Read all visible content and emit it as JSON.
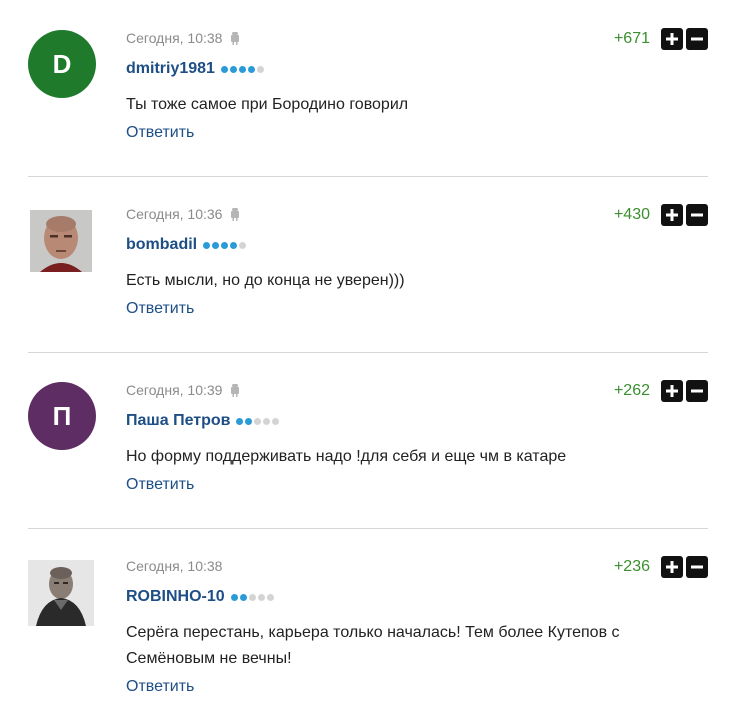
{
  "comments": [
    {
      "time": "Сегодня, 10:38",
      "author": "dmitriy1981",
      "rating_filled": 4,
      "rating_total": 5,
      "score": "+671",
      "text": "Ты тоже самое при Бородино говорил",
      "reply": "Ответить",
      "avatar_letter": "D",
      "avatar_color": "#1f7a2c",
      "mobile": true
    },
    {
      "time": "Сегодня, 10:36",
      "author": "bombadil",
      "rating_filled": 4,
      "rating_total": 5,
      "score": "+430",
      "text": "Есть мысли, но до конца не уверен)))",
      "reply": "Ответить",
      "avatar_type": "photo",
      "mobile": true
    },
    {
      "time": "Сегодня, 10:39",
      "author": "Паша Петров",
      "rating_filled": 2,
      "rating_total": 5,
      "score": "+262",
      "text": "Но форму поддерживать надо !для себя и еще чм в катаре",
      "reply": "Ответить",
      "avatar_letter": "П",
      "avatar_color": "#5e2d63",
      "mobile": true
    },
    {
      "time": "Сегодня, 10:38",
      "author": "ROBINHO-10",
      "rating_filled": 2,
      "rating_total": 5,
      "score": "+236",
      "text": "Серёга перестань, карьера только началась! Тем более Кутепов с Семёновым не вечны!",
      "reply": "Ответить",
      "avatar_type": "photo",
      "mobile": false
    }
  ],
  "icons": {
    "upvote": "plus-icon",
    "downvote": "minus-icon",
    "device": "android-icon"
  },
  "colors": {
    "author": "#1e4e86",
    "score": "#3a8f2e",
    "rating_on": "#2a9bd8"
  }
}
